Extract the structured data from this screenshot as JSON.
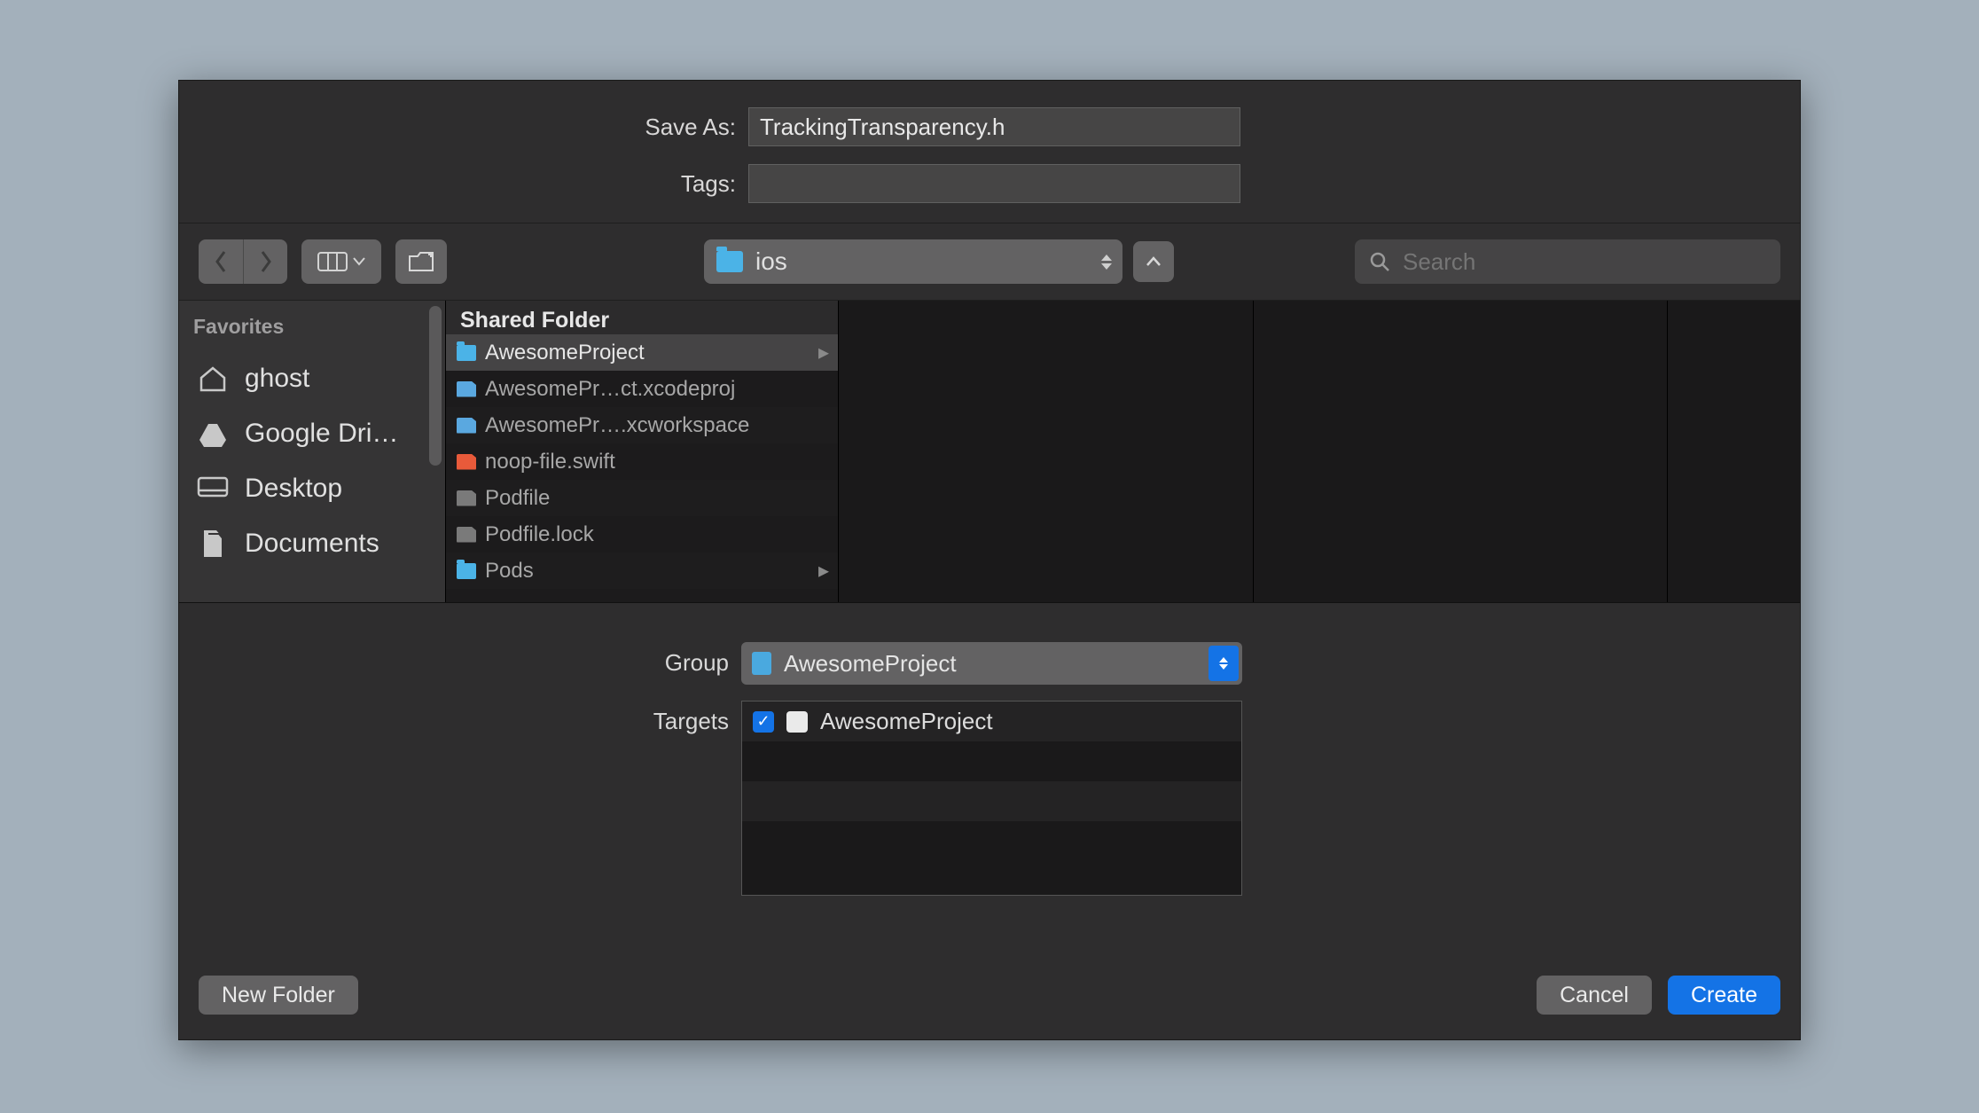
{
  "saveAs": {
    "label": "Save As:",
    "value": "TrackingTransparency.h"
  },
  "tags": {
    "label": "Tags:",
    "value": ""
  },
  "location": {
    "current": "ios"
  },
  "search": {
    "placeholder": "Search"
  },
  "sidebar": {
    "header": "Favorites",
    "items": [
      {
        "icon": "home",
        "label": "ghost"
      },
      {
        "icon": "gdrive",
        "label": "Google Dri…"
      },
      {
        "icon": "desktop",
        "label": "Desktop"
      },
      {
        "icon": "document",
        "label": "Documents"
      }
    ]
  },
  "column": {
    "header": "Shared Folder",
    "files": [
      {
        "kind": "folder",
        "name": "AwesomeProject",
        "hasChildren": true,
        "selected": true
      },
      {
        "kind": "xcode",
        "name": "AwesomePr…ct.xcodeproj"
      },
      {
        "kind": "xcode",
        "name": "AwesomePr….xcworkspace"
      },
      {
        "kind": "swift",
        "name": "noop-file.swift"
      },
      {
        "kind": "generic",
        "name": "Podfile"
      },
      {
        "kind": "generic",
        "name": "Podfile.lock"
      },
      {
        "kind": "folder",
        "name": "Pods",
        "hasChildren": true
      }
    ]
  },
  "group": {
    "label": "Group",
    "value": "AwesomeProject"
  },
  "targets": {
    "label": "Targets",
    "items": [
      {
        "name": "AwesomeProject",
        "checked": true
      }
    ]
  },
  "buttons": {
    "newFolder": "New Folder",
    "cancel": "Cancel",
    "create": "Create"
  }
}
